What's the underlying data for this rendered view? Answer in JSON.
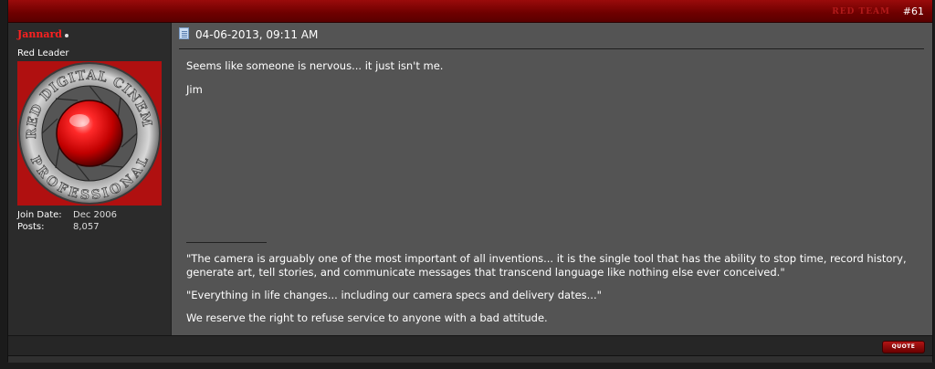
{
  "post": {
    "number": "#61",
    "team_tag": "RED TEAM",
    "date": "04-06-2013, 09:11 AM",
    "message": [
      "Seems like someone is nervous... it just isn't me.",
      "Jim"
    ],
    "signature": [
      "\"The camera is arguably one of the most important of all inventions... it is the single tool that has the ability to stop time, record history, generate art, tell stories, and communicate messages that transcend language like nothing else ever conceived.\"",
      "\"Everything in life changes... including our camera specs and delivery dates...\"",
      "We reserve the right to refuse service to anyone with a bad attitude."
    ],
    "quote_label": "QUOTE"
  },
  "user": {
    "name": "Jannard",
    "title": "Red Leader",
    "avatar_top_text": "RED DIGITAL CINEMA",
    "avatar_bottom_text": "PROFESSIONAL",
    "stats": [
      {
        "label": "Join Date:",
        "value": "Dec 2006"
      },
      {
        "label": "Posts:",
        "value": "8,057"
      }
    ]
  },
  "colors": {
    "accent": "#9a0b0b",
    "username": "#ff2020",
    "post_bg": "#545454",
    "sidebar_bg": "#2b2b2b"
  },
  "icons": {
    "post_icon": "post-icon",
    "online": "online-status-icon"
  }
}
